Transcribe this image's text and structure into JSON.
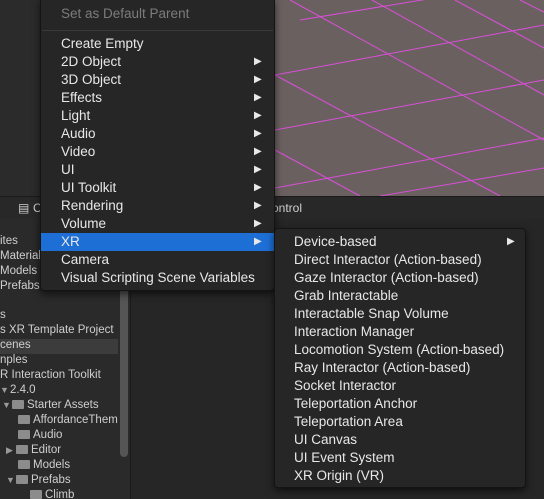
{
  "scene": {
    "grid_color": "#d94fd9",
    "background_color": "#6b6060"
  },
  "tabs": {
    "console_icon": "console-icon",
    "console_label": "C",
    "control_label": "ontrol"
  },
  "project": {
    "rows": [
      "ites",
      "Material",
      "Models",
      "Prefabs",
      "s",
      "s XR Template Project",
      "cenes",
      "nples",
      "R Interaction Toolkit",
      "2.4.0",
      "Starter Assets",
      "AffordanceThem",
      "Audio",
      "Editor",
      "Models",
      "Prefabs",
      "Climb"
    ]
  },
  "main_menu": {
    "items": [
      {
        "label": "Set as Default Parent",
        "submenu": false,
        "disabled": true
      },
      {
        "label": "Create Empty",
        "submenu": false
      },
      {
        "label": "2D Object",
        "submenu": true
      },
      {
        "label": "3D Object",
        "submenu": true
      },
      {
        "label": "Effects",
        "submenu": true
      },
      {
        "label": "Light",
        "submenu": true
      },
      {
        "label": "Audio",
        "submenu": true
      },
      {
        "label": "Video",
        "submenu": true
      },
      {
        "label": "UI",
        "submenu": true
      },
      {
        "label": "UI Toolkit",
        "submenu": true
      },
      {
        "label": "Rendering",
        "submenu": true
      },
      {
        "label": "Volume",
        "submenu": true
      },
      {
        "label": "XR",
        "submenu": true,
        "active": true
      },
      {
        "label": "Camera",
        "submenu": false
      },
      {
        "label": "Visual Scripting Scene Variables",
        "submenu": false
      }
    ],
    "arrow_glyph": "▶"
  },
  "xr_menu": {
    "items": [
      {
        "label": "Device-based",
        "submenu": true
      },
      {
        "label": "Direct Interactor (Action-based)"
      },
      {
        "label": "Gaze Interactor (Action-based)"
      },
      {
        "label": "Grab Interactable"
      },
      {
        "label": "Interactable Snap Volume"
      },
      {
        "label": "Interaction Manager"
      },
      {
        "label": "Locomotion System (Action-based)"
      },
      {
        "label": "Ray Interactor (Action-based)"
      },
      {
        "label": "Socket Interactor"
      },
      {
        "label": "Teleportation Anchor"
      },
      {
        "label": "Teleportation Area"
      },
      {
        "label": "UI Canvas"
      },
      {
        "label": "UI Event System"
      },
      {
        "label": "XR Origin (VR)"
      }
    ]
  },
  "colors": {
    "highlight": "#1d6fd6",
    "menu_bg": "#262626"
  }
}
